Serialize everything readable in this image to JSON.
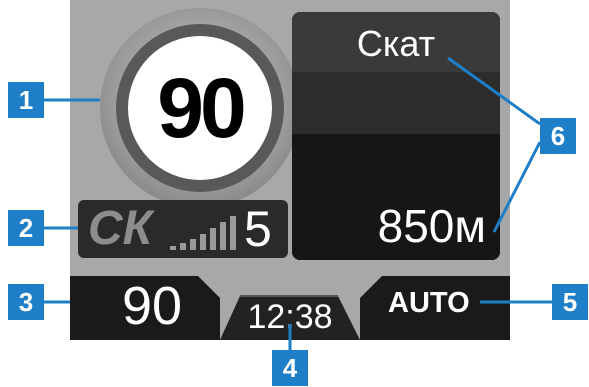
{
  "speed_limit": {
    "value": "90"
  },
  "radar": {
    "type": "СК",
    "signal_level": "5"
  },
  "camera": {
    "name": "Скат",
    "distance": "850м"
  },
  "status_bar": {
    "current_speed": "90",
    "clock": "12:38",
    "mode": "AUTO"
  },
  "callouts": [
    {
      "number": "1"
    },
    {
      "number": "2"
    },
    {
      "number": "3"
    },
    {
      "number": "4"
    },
    {
      "number": "5"
    },
    {
      "number": "6"
    }
  ],
  "colors": {
    "callout_blue": "#1e7ec8",
    "panel_dark": "#1c1c1c",
    "screen_gray": "#a8a8a8"
  }
}
